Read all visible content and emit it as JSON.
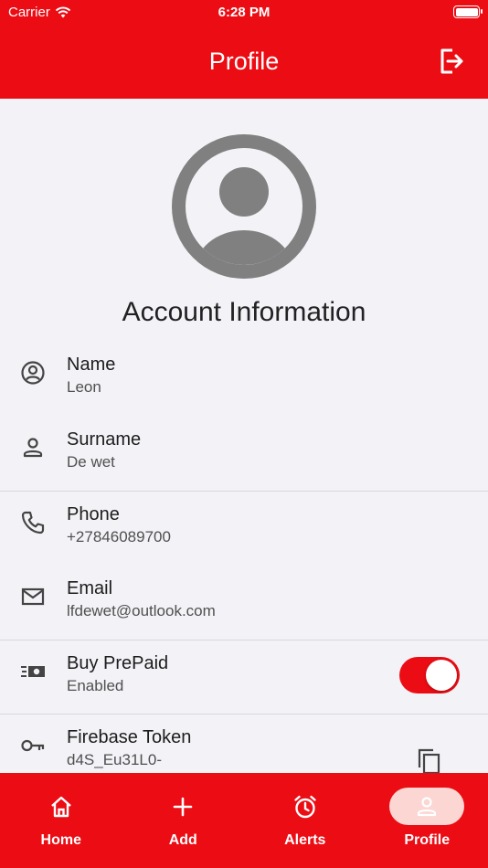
{
  "status_bar": {
    "carrier": "Carrier",
    "time": "6:28 PM"
  },
  "header": {
    "title": "Profile"
  },
  "profile": {
    "section_title": "Account Information"
  },
  "fields": [
    {
      "label": "Name",
      "value": "Leon",
      "icon": "account-circle-icon"
    },
    {
      "label": "Surname",
      "value": "De wet",
      "icon": "person-icon"
    },
    {
      "label": "Phone",
      "value": "+27846089700",
      "icon": "phone-icon"
    },
    {
      "label": "Email",
      "value": "lfdewet@outlook.com",
      "icon": "mail-icon"
    },
    {
      "label": "Buy PrePaid",
      "value": "Enabled",
      "icon": "cash-icon",
      "toggle_on": true
    },
    {
      "label": "Firebase Token",
      "value": "d4S_Eu31L0-",
      "icon": "key-icon"
    }
  ],
  "tabs": [
    {
      "label": "Home",
      "icon": "home-icon",
      "active": false
    },
    {
      "label": "Add",
      "icon": "plus-icon",
      "active": false
    },
    {
      "label": "Alerts",
      "icon": "alarm-icon",
      "active": false
    },
    {
      "label": "Profile",
      "icon": "person-icon",
      "active": true
    }
  ],
  "colors": {
    "brand": "#ec0c14",
    "active_tab_pill": "#fbd6d3",
    "icon_gray": "#808080"
  }
}
